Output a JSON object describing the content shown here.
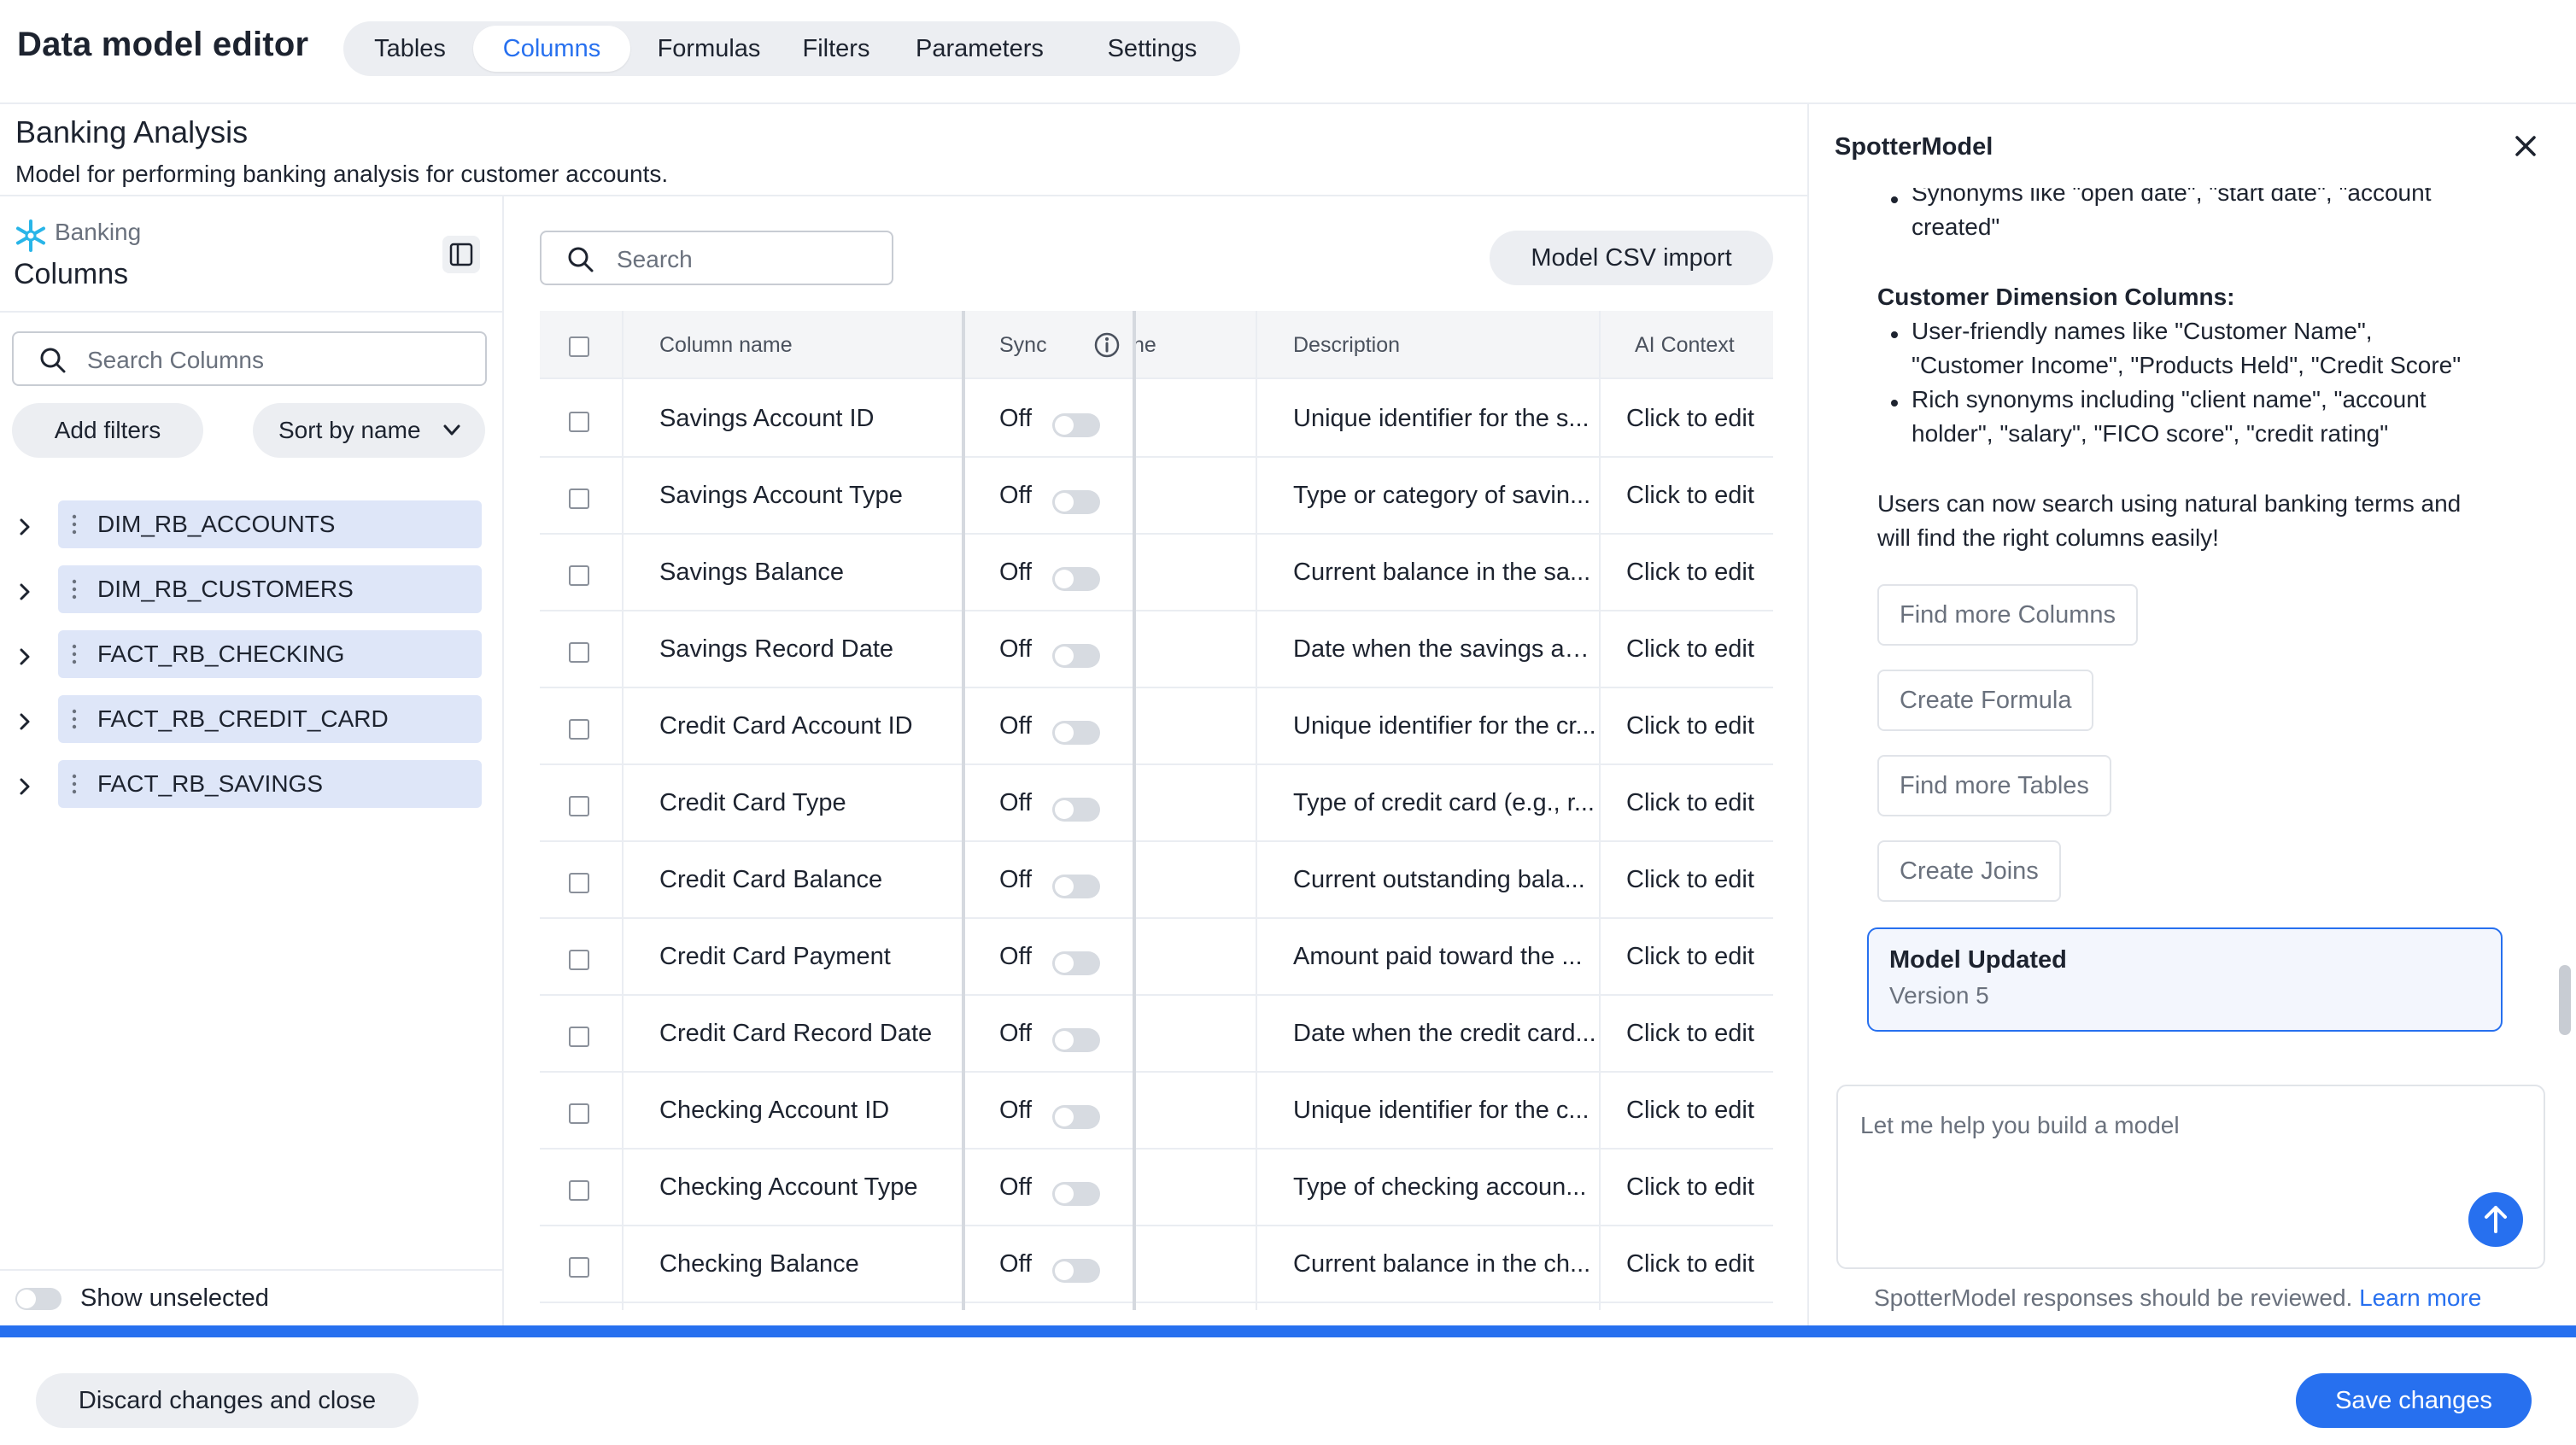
{
  "header": {
    "title": "Data model editor",
    "tabs": [
      {
        "label": "Tables",
        "active": false
      },
      {
        "label": "Columns",
        "active": true
      },
      {
        "label": "Formulas",
        "active": false
      },
      {
        "label": "Filters",
        "active": false
      },
      {
        "label": "Parameters",
        "active": false
      },
      {
        "label": "Settings",
        "active": false
      }
    ]
  },
  "model": {
    "name": "Banking Analysis",
    "description": "Model for performing banking analysis for customer accounts."
  },
  "left_panel": {
    "source_name": "Banking",
    "source_icon": "snowflake-icon",
    "title": "Columns",
    "search_placeholder": "Search Columns",
    "add_filters_label": "Add filters",
    "sort_label": "Sort by name",
    "tables": [
      {
        "label": "DIM_RB_ACCOUNTS"
      },
      {
        "label": "DIM_RB_CUSTOMERS"
      },
      {
        "label": "FACT_RB_CHECKING"
      },
      {
        "label": "FACT_RB_CREDIT_CARD"
      },
      {
        "label": "FACT_RB_SAVINGS"
      }
    ],
    "show_unselected_label": "Show unselected",
    "show_unselected_on": false
  },
  "center": {
    "search_placeholder": "Search",
    "csv_import_label": "Model CSV import",
    "columns": {
      "name": "Column name",
      "sync": "Sync",
      "partial": "ne",
      "description": "Description",
      "ai_context": "AI Context"
    },
    "rows": [
      {
        "name": "Savings Account ID",
        "sync": "Off",
        "description": "Unique identifier for the s...",
        "ai": "Click to edit"
      },
      {
        "name": "Savings Account Type",
        "sync": "Off",
        "description": "Type or category of savin...",
        "ai": "Click to edit"
      },
      {
        "name": "Savings Balance",
        "sync": "Off",
        "description": "Current balance in the sa...",
        "ai": "Click to edit"
      },
      {
        "name": "Savings Record Date",
        "sync": "Off",
        "description": "Date when the savings ac...",
        "ai": "Click to edit"
      },
      {
        "name": "Credit Card Account ID",
        "sync": "Off",
        "description": "Unique identifier for the cr...",
        "ai": "Click to edit"
      },
      {
        "name": "Credit Card Type",
        "sync": "Off",
        "description": "Type of credit card (e.g., r...",
        "ai": "Click to edit"
      },
      {
        "name": "Credit Card Balance",
        "sync": "Off",
        "description": "Current outstanding bala...",
        "ai": "Click to edit"
      },
      {
        "name": "Credit Card Payment",
        "sync": "Off",
        "description": "Amount paid toward the ...",
        "ai": "Click to edit"
      },
      {
        "name": "Credit Card Record Date",
        "sync": "Off",
        "description": "Date when the credit card...",
        "ai": "Click to edit"
      },
      {
        "name": "Checking Account ID",
        "sync": "Off",
        "description": "Unique identifier for the c...",
        "ai": "Click to edit"
      },
      {
        "name": "Checking Account Type",
        "sync": "Off",
        "description": "Type of checking accoun...",
        "ai": "Click to edit"
      },
      {
        "name": "Checking Balance",
        "sync": "Off",
        "description": "Current balance in the ch...",
        "ai": "Click to edit"
      }
    ]
  },
  "right_panel": {
    "title": "SpotterModel",
    "messages": {
      "partial_bullet_line1": "Synonyms like \"open date\", \"start date\", \"account",
      "partial_bullet_line2": "created\"",
      "section_heading": "Customer Dimension Columns:",
      "bullet1_line1": "User-friendly names like \"Customer Name\",",
      "bullet1_line2": "\"Customer Income\", \"Products Held\", \"Credit Score\"",
      "bullet2_line1": "Rich synonyms including \"client name\", \"account",
      "bullet2_line2": "holder\", \"salary\", \"FICO score\", \"credit rating\"",
      "closing_line1": "Users can now search using natural banking terms and",
      "closing_line2": "will find the right columns easily!"
    },
    "suggestions": [
      {
        "label": "Find more Columns"
      },
      {
        "label": "Create Formula"
      },
      {
        "label": "Find more Tables"
      },
      {
        "label": "Create Joins"
      }
    ],
    "status_card": {
      "title": "Model Updated",
      "subtitle": "Version 5"
    },
    "input_placeholder": "Let me help you build a model",
    "disclaimer": "SpotterModel responses should be reviewed.",
    "learn_more": "Learn more"
  },
  "footer": {
    "discard_label": "Discard changes and close",
    "save_label": "Save changes"
  },
  "colors": {
    "accent": "#2770ef",
    "pill_bg": "#dee6f8",
    "button_bg": "#eceef2"
  }
}
